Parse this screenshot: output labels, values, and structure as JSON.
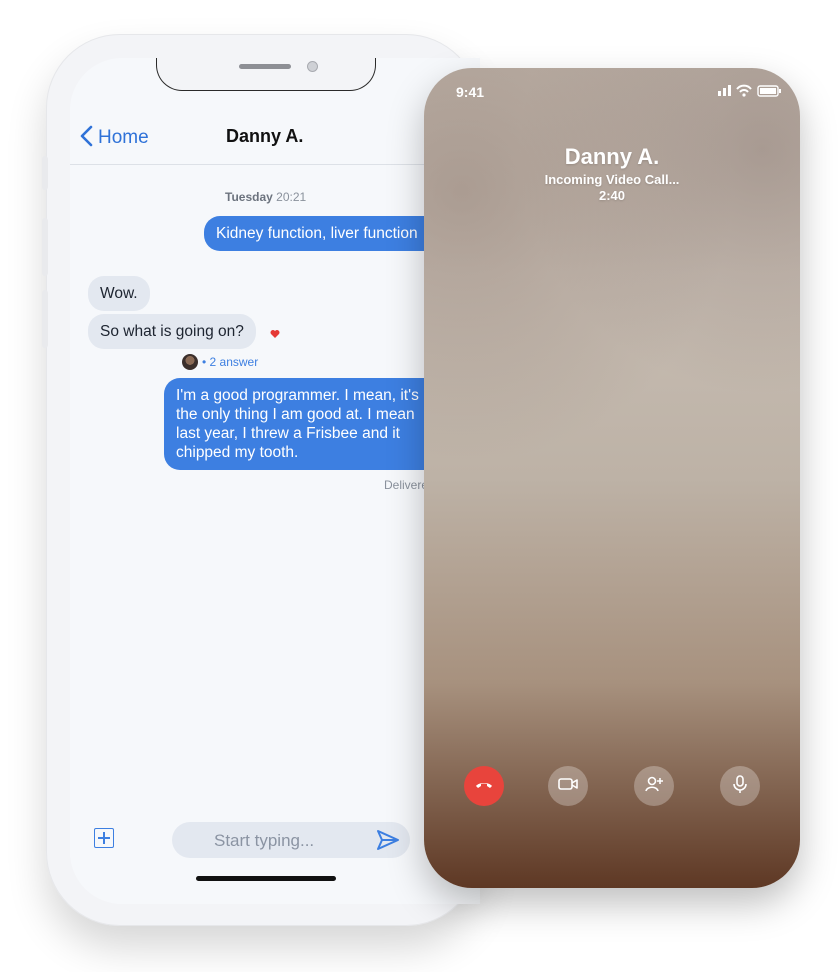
{
  "chat": {
    "back_label": "Home",
    "title": "Danny A.",
    "timestamp_day": "Tuesday",
    "timestamp_time": "20:21",
    "messages": [
      {
        "direction": "out",
        "text": "Kidney function, liver function"
      },
      {
        "direction": "in",
        "text": "Wow."
      },
      {
        "direction": "in",
        "text": "So what is going on?"
      },
      {
        "direction": "out",
        "lines": [
          "I'm a good programmer. I mean, it's",
          "the only thing I am good at. I mean",
          "last year, I threw a Frisbee and it",
          "chipped my tooth."
        ]
      }
    ],
    "reply_count": "• 2 answer",
    "delivered": "Delivered",
    "composer_placeholder": "Start typing..."
  },
  "call": {
    "time": "9:41",
    "caller_name": "Danny A.",
    "status": "Incoming Video Call...",
    "timer": "2:40"
  },
  "colors": {
    "accent": "#3d7fe1",
    "end_call": "#e8443c",
    "heart": "#e53935"
  },
  "icons": [
    "chevron-left-icon",
    "heart-icon",
    "plus-square-icon",
    "send-icon",
    "signal-icon",
    "wifi-icon",
    "battery-icon",
    "end-call-icon",
    "video-icon",
    "add-person-icon",
    "microphone-icon"
  ]
}
